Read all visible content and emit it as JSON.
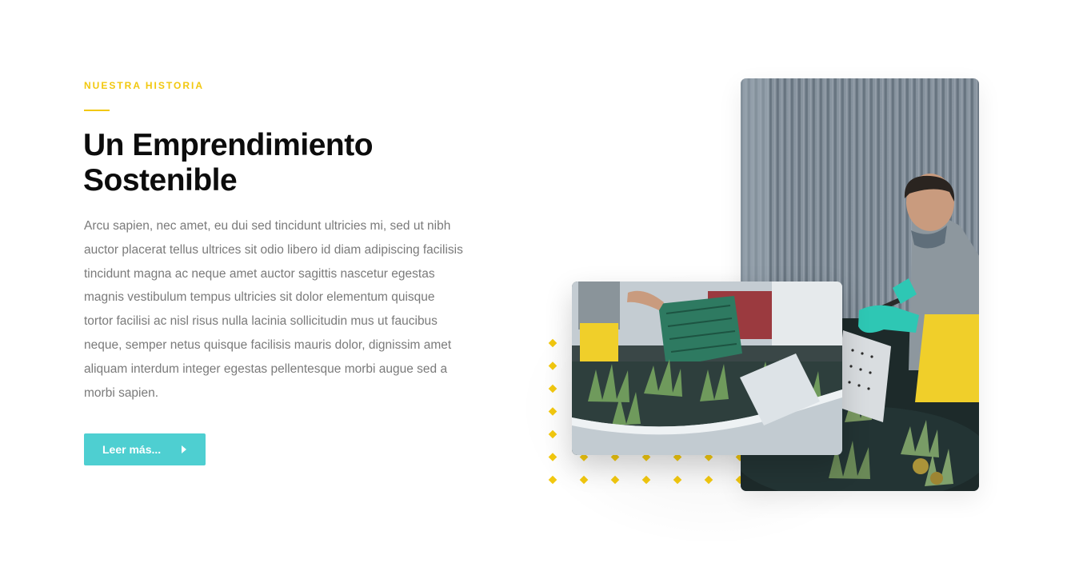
{
  "section": {
    "eyebrow": "NUESTRA HISTORIA",
    "title_line1": "Un Emprendimiento",
    "title_line2": "Sostenible",
    "body": "Arcu sapien, nec amet, eu dui sed tincidunt ultricies mi, sed ut nibh auctor placerat tellus ultrices sit odio libero id diam adipiscing facilisis tincidunt magna ac neque amet auctor sagittis nascetur egestas magnis vestibulum tempus ultricies sit dolor elementum quisque tortor facilisi ac nisl risus nulla lacinia sollicitudin mus ut faucibus neque, semper netus quisque facilisis mauris dolor, dignissim amet aliquam interdum integer egestas pellentesque morbi augue sed a morbi sapien.",
    "cta_label": "Leer más...",
    "cta_icon": "caret-right-icon"
  },
  "images": {
    "worker_photo": "photo-worker-washing-pineapples",
    "crate_photo": "photo-pineapples-in-wash-tank"
  },
  "colors": {
    "accent_yellow": "#f2c80f",
    "button_teal": "#4ecfd1",
    "heading": "#0c0c0c",
    "body_text": "#7a7a7a"
  }
}
